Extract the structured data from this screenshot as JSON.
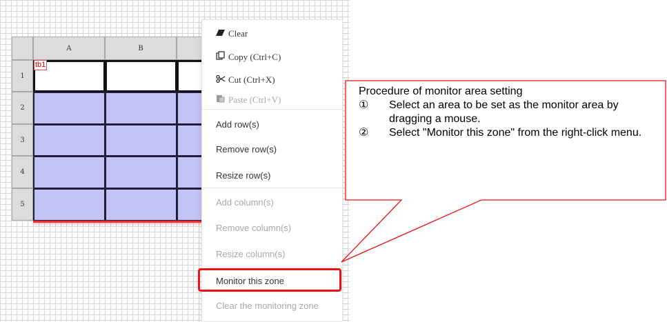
{
  "sheet": {
    "columns": [
      "A",
      "B"
    ],
    "rows": [
      "1",
      "2",
      "3",
      "4",
      "5"
    ],
    "table_tag": "tb1"
  },
  "menu": {
    "items": [
      {
        "label": "Clear",
        "icon": "eraser-icon",
        "disabled": false
      },
      {
        "label": "Copy (Ctrl+C)",
        "icon": "copy-icon",
        "disabled": false
      },
      {
        "label": "Cut (Ctrl+X)",
        "icon": "scissors-icon",
        "disabled": false
      },
      {
        "label": "Paste (Ctrl+V)",
        "icon": "paste-icon",
        "disabled": true
      },
      {
        "label": "Add row(s)",
        "disabled": false
      },
      {
        "label": "Remove row(s)",
        "disabled": false
      },
      {
        "label": "Resize row(s)",
        "disabled": false
      },
      {
        "label": "Add column(s)",
        "disabled": true
      },
      {
        "label": "Remove column(s)",
        "disabled": true
      },
      {
        "label": "Resize column(s)",
        "disabled": true
      },
      {
        "label": "Monitor this zone",
        "disabled": false
      },
      {
        "label": "Clear the monitoring zone",
        "disabled": true
      }
    ]
  },
  "callout": {
    "title": "Procedure of monitor area setting",
    "steps": [
      {
        "num": "①",
        "text": "Select an area to be set as the monitor area by dragging a mouse."
      },
      {
        "num": "②",
        "text": "Select \"Monitor this zone\" from the right-click menu."
      }
    ]
  },
  "colors": {
    "selection_fill": "#c3c3f5",
    "highlight_red": "#ee1111"
  }
}
